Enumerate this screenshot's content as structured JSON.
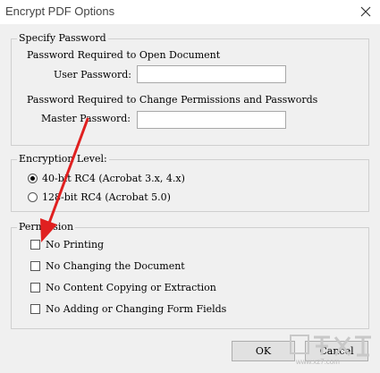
{
  "window": {
    "title": "Encrypt PDF Options"
  },
  "password_group": {
    "legend": "Specify Password",
    "open_doc_heading": "Password Required to Open Document",
    "user_password_label": "User Password:",
    "user_password_value": "",
    "permissions_heading": "Password Required to Change Permissions and Passwords",
    "master_password_label": "Master Password:",
    "master_password_value": ""
  },
  "encryption_group": {
    "legend": "Encryption Level:",
    "options": [
      {
        "label": "40-bit RC4 (Acrobat 3.x, 4.x)",
        "selected": true
      },
      {
        "label": "128-bit RC4 (Acrobat 5.0)",
        "selected": false
      }
    ]
  },
  "permission_group": {
    "legend": "Permission",
    "options": [
      {
        "label": "No Printing",
        "checked": false
      },
      {
        "label": "No Changing the Document",
        "checked": false
      },
      {
        "label": "No Content Copying or Extraction",
        "checked": false
      },
      {
        "label": "No Adding or Changing Form Fields",
        "checked": false
      }
    ]
  },
  "buttons": {
    "ok": "OK",
    "cancel": "Cancel"
  },
  "annotation": {
    "arrow_color": "#e02020"
  },
  "watermark": {
    "site": "www.xz7.com"
  }
}
